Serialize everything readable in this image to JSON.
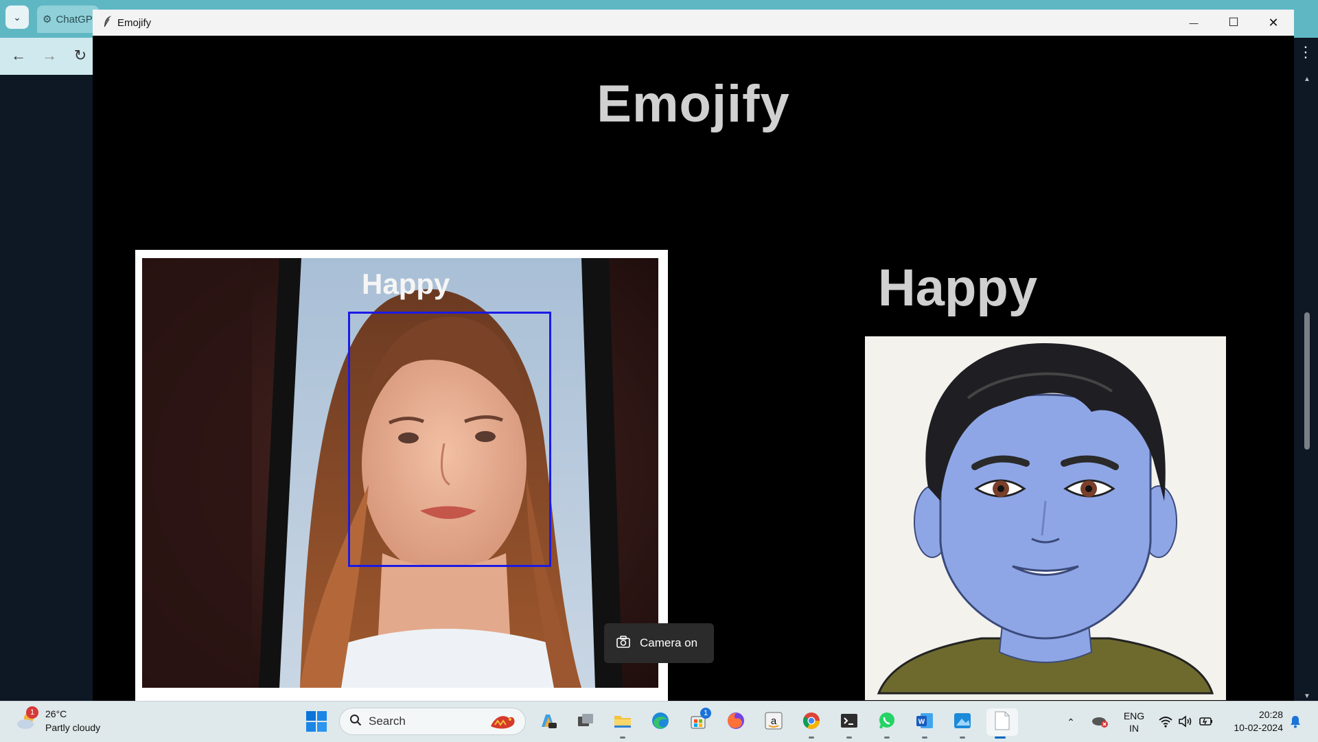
{
  "browser": {
    "tab_title": "ChatGPT",
    "nav": {
      "back": "←",
      "forward": "→",
      "reload": "↻"
    }
  },
  "window": {
    "title": "Emojify",
    "controls": {
      "minimize": "—",
      "maximize": "☐",
      "close": "✕"
    }
  },
  "app": {
    "heading": "Emojify",
    "camera": {
      "face_label": "Happy"
    },
    "emotion_label": "Happy"
  },
  "toast": {
    "text": "Camera on"
  },
  "taskbar": {
    "weather": {
      "temp": "26°C",
      "condition": "Partly cloudy",
      "badge": "1"
    },
    "search_placeholder": "Search",
    "store_badge": "1",
    "language": {
      "line1": "ENG",
      "line2": "IN"
    },
    "clock": {
      "time": "20:28",
      "date": "10-02-2024"
    }
  },
  "colors": {
    "face_box": "#1a1ae6",
    "emoji_skin": "#8fa6e6",
    "title_text": "#d0d0d0"
  }
}
